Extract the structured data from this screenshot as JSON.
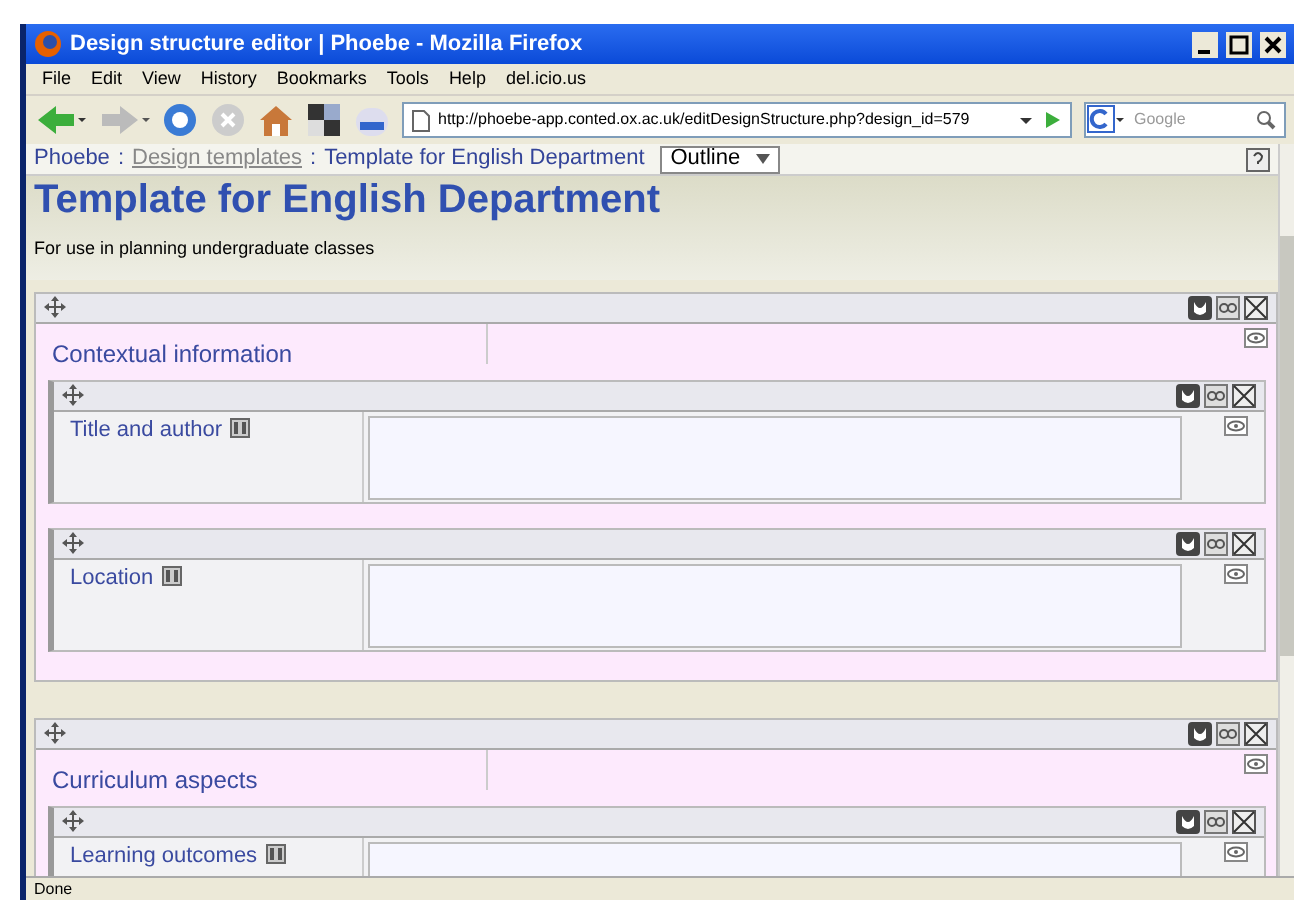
{
  "window": {
    "title": "Design structure editor | Phoebe - Mozilla Firefox"
  },
  "menu": [
    "File",
    "Edit",
    "View",
    "History",
    "Bookmarks",
    "Tools",
    "Help",
    "del.icio.us"
  ],
  "address_bar": {
    "value": "http://phoebe-app.conted.ox.ac.uk/editDesignStructure.php?design_id=579"
  },
  "search": {
    "placeholder": "Google"
  },
  "breadcrumb": [
    {
      "label": "Phoebe",
      "kind": "link"
    },
    {
      "label": ":",
      "kind": "sep"
    },
    {
      "label": "Design templates",
      "kind": "visited"
    },
    {
      "label": ":",
      "kind": "sep"
    },
    {
      "label": "Template for English Department",
      "kind": "link"
    }
  ],
  "view_select": {
    "value": "Outline"
  },
  "page": {
    "title": "Template for English Department",
    "description": "For use in planning undergraduate classes"
  },
  "sections": [
    {
      "title": "Contextual information",
      "fields": [
        {
          "label": "Title and author"
        },
        {
          "label": "Location"
        }
      ]
    },
    {
      "title": "Curriculum aspects",
      "fields": [
        {
          "label": "Learning outcomes"
        }
      ]
    }
  ],
  "status_bar": "Done"
}
